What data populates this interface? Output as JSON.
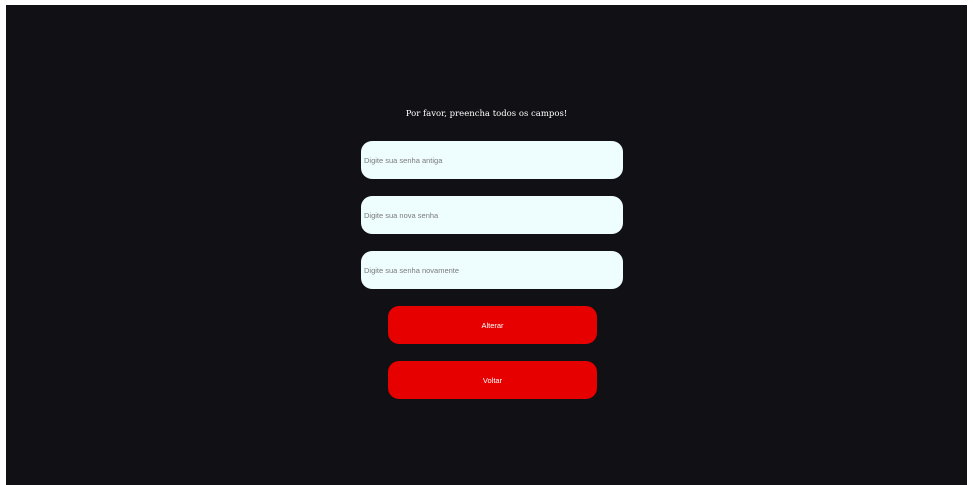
{
  "form": {
    "message": "Por favor, preencha todos os campos!",
    "old_password": {
      "placeholder": "Digite sua senha antiga",
      "value": ""
    },
    "new_password": {
      "placeholder": "Digite sua nova senha",
      "value": ""
    },
    "confirm_password": {
      "placeholder": "Digite sua senha novamente",
      "value": ""
    },
    "submit_label": "Alterar",
    "back_label": "Voltar"
  },
  "colors": {
    "background": "#111014",
    "input_background": "#eefdfe",
    "button_background": "#e60000",
    "text": "#ffffff"
  }
}
